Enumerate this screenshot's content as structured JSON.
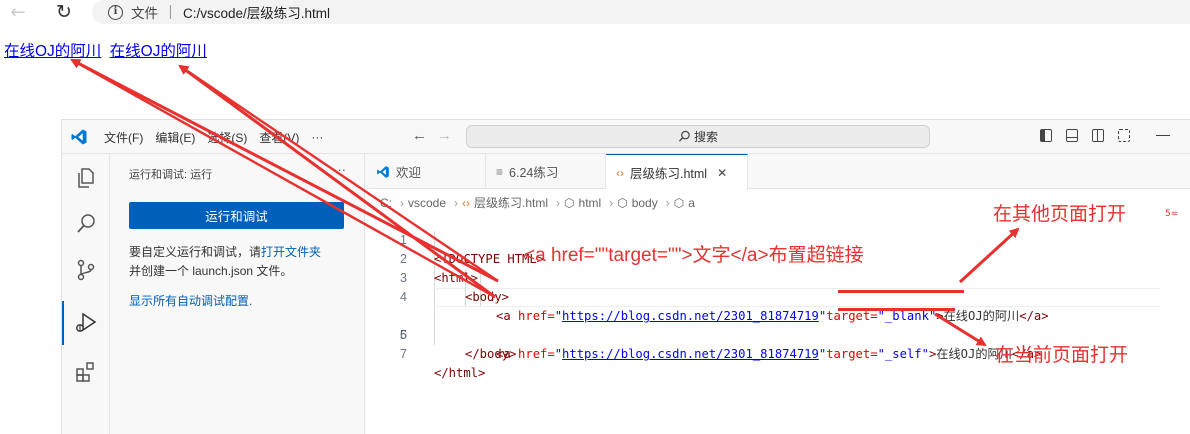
{
  "browser": {
    "back_icon": "back-arrow-icon",
    "reload_icon": "reload-icon",
    "info_label": "文件",
    "url": "C:/vscode/层级练习.html"
  },
  "page": {
    "links": [
      "在线OJ的阿川",
      "在线OJ的阿川"
    ]
  },
  "vscode": {
    "menu": [
      "文件(F)",
      "编辑(E)",
      "选择(S)",
      "查看(V)",
      "···"
    ],
    "search_label": "搜索",
    "sidebar": {
      "title": "运行和调试: 运行",
      "more": "···",
      "run_button": "运行和调试",
      "text_before_link": "要自定义运行和调试，请",
      "text_link": "打开文件夹",
      "text_after_link": "并创建一个 launch.json 文件。",
      "auto_config_link": "显示所有自动调试配置."
    },
    "tabs": [
      {
        "label": "欢迎",
        "icon": "vscode-logo-icon"
      },
      {
        "label": "6.24练习",
        "icon": "file-lines-icon"
      },
      {
        "label": "层级练习.html",
        "icon": "code-brackets-icon",
        "active": true
      }
    ],
    "breadcrumb": [
      "C:",
      "vscode",
      "层级练习.html",
      "html",
      "body",
      "a"
    ],
    "code": {
      "line_numbers": [
        "1",
        "2",
        "3",
        "4",
        "5",
        "6",
        "7"
      ],
      "l1": "<!DOCTYPE HTML>",
      "l2": "<html>",
      "l3": "<body>",
      "open_a": "<a ",
      "href_attr": "href=",
      "q": "\"",
      "url": "https://blog.csdn.net/2301_81874719",
      "target_attr": "target=",
      "target_blank": "\"_blank\"",
      "target_self": "\"_self\"",
      "gt": ">",
      "link_text": "在线OJ的阿川",
      "close_a": "</a>",
      "l6": "</body>",
      "l7": "</html>"
    }
  },
  "annotations": {
    "center": "<a href=\"\"target=\"\">文字</a>布置超链接",
    "blank": "在其他页面打开",
    "self": "在当前页面打开",
    "thumb": "5=",
    "color": "#e8312f"
  }
}
